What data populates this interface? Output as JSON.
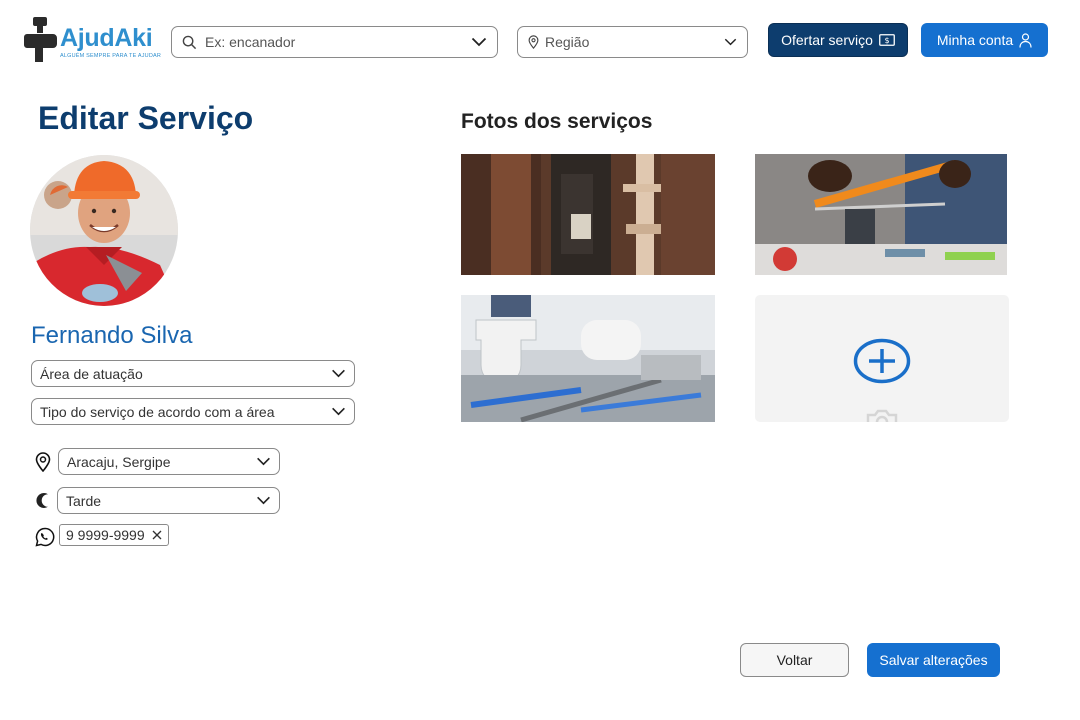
{
  "header": {
    "logo_title": "AjudAki",
    "logo_subtitle": "ALGUÉM SEMPRE PARA TE AJUDAR",
    "search_placeholder": "Ex: encanador",
    "region_placeholder": "Região",
    "offer_button": "Ofertar serviço",
    "account_button": "Minha conta"
  },
  "profile": {
    "page_title": "Editar Serviço",
    "name": "Fernando Silva",
    "area_select": "Área de atuação",
    "type_select": "Tipo do serviço de acordo com a área",
    "location": "Aracaju, Sergipe",
    "period": "Tarde",
    "phone": "9 9999-9999"
  },
  "photos": {
    "title": "Fotos dos serviços"
  },
  "footer": {
    "back_button": "Voltar",
    "save_button": "Salvar alterações"
  },
  "colors": {
    "brand_dark": "#0d3d6e",
    "brand_primary": "#1570d0",
    "logo_blue": "#2f8fce"
  }
}
